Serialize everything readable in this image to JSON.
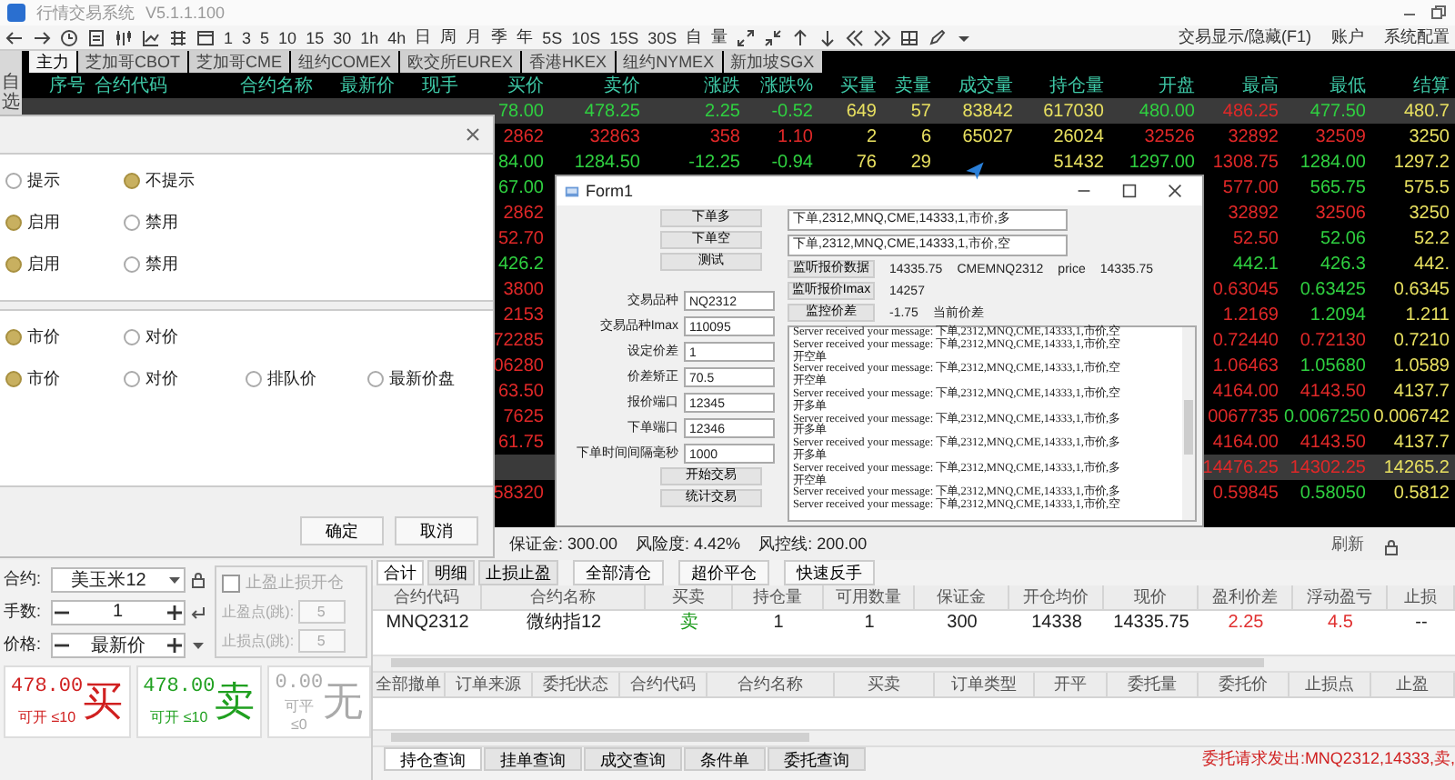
{
  "window": {
    "title": "行情交易系统",
    "version": "V5.1.1.100"
  },
  "toolbar": {
    "periods": [
      "1",
      "3",
      "5",
      "10",
      "15",
      "30",
      "1h",
      "4h",
      "日",
      "周",
      "月",
      "季",
      "年",
      "5S",
      "10S",
      "15S",
      "30S",
      "自",
      "量"
    ],
    "links": [
      "交易显示/隐藏(F1)",
      "账户",
      "系统配置"
    ]
  },
  "market_tabs": [
    {
      "label": "主力",
      "selected": true
    },
    {
      "label": "芝加哥CBOT",
      "selected": false
    },
    {
      "label": "芝加哥CME",
      "selected": false
    },
    {
      "label": "纽约COMEX",
      "selected": false
    },
    {
      "label": "欧交所EUREX",
      "selected": false
    },
    {
      "label": "香港HKEX",
      "selected": false
    },
    {
      "label": "纽约NYMEX",
      "selected": false
    },
    {
      "label": "新加坡SGX",
      "selected": false
    }
  ],
  "watchlist_label": "自选",
  "quote_table": {
    "columns": [
      "序号",
      "合约代码",
      "合约名称",
      "最新价",
      "现手",
      "买价",
      "卖价",
      "涨跌",
      "涨跌%",
      "买量",
      "卖量",
      "成交量",
      "持仓量",
      "开盘",
      "最高",
      "最低",
      "结算"
    ],
    "rows": [
      {
        "selected": true,
        "cells": [
          null,
          null,
          null,
          null,
          null,
          {
            "text": "78.00",
            "color": "#2fd040"
          },
          {
            "text": "478.25",
            "color": "#2fd040"
          },
          {
            "text": "2.25",
            "color": "#2fd040"
          },
          {
            "text": "-0.52",
            "color": "#2fd040"
          },
          {
            "text": "649",
            "color": "#e8e060"
          },
          {
            "text": "57",
            "color": "#e8e060"
          },
          {
            "text": "83842",
            "color": "#e8e060"
          },
          {
            "text": "617030",
            "color": "#e8e060"
          },
          {
            "text": "480.00",
            "color": "#2fd040"
          },
          {
            "text": "486.25",
            "color": "#e02828"
          },
          {
            "text": "477.50",
            "color": "#2fd040"
          },
          {
            "text": "480.7",
            "color": "#e8e060"
          }
        ]
      },
      {
        "selected": false,
        "cells": [
          null,
          null,
          null,
          null,
          null,
          {
            "text": "2862",
            "color": "#e02828"
          },
          {
            "text": "32863",
            "color": "#e02828"
          },
          {
            "text": "358",
            "color": "#e02828"
          },
          {
            "text": "1.10",
            "color": "#e02828"
          },
          {
            "text": "2",
            "color": "#e8e060"
          },
          {
            "text": "6",
            "color": "#e8e060"
          },
          {
            "text": "65027",
            "color": "#e8e060"
          },
          {
            "text": "26024",
            "color": "#e8e060"
          },
          {
            "text": "32526",
            "color": "#e02828"
          },
          {
            "text": "32892",
            "color": "#e02828"
          },
          {
            "text": "32509",
            "color": "#e02828"
          },
          {
            "text": "3250",
            "color": "#e8e060"
          }
        ]
      },
      {
        "selected": false,
        "cells": [
          null,
          null,
          null,
          null,
          null,
          {
            "text": "84.00",
            "color": "#2fd040"
          },
          {
            "text": "1284.50",
            "color": "#2fd040"
          },
          {
            "text": "-12.25",
            "color": "#2fd040"
          },
          {
            "text": "-0.94",
            "color": "#2fd040"
          },
          {
            "text": "76",
            "color": "#e8e060"
          },
          {
            "text": "29",
            "color": "#e8e060"
          },
          null,
          {
            "text": "51432",
            "color": "#e8e060"
          },
          {
            "text": "1297.00",
            "color": "#2fd040"
          },
          {
            "text": "1308.75",
            "color": "#e02828"
          },
          {
            "text": "1284.00",
            "color": "#2fd040"
          },
          {
            "text": "1297.2",
            "color": "#e8e060"
          }
        ]
      },
      {
        "selected": false,
        "cells": [
          null,
          null,
          null,
          null,
          null,
          {
            "text": "67.00",
            "color": "#2fd040"
          },
          null,
          null,
          null,
          null,
          null,
          null,
          null,
          null,
          {
            "text": "577.00",
            "color": "#e02828"
          },
          {
            "text": "565.75",
            "color": "#2fd040"
          },
          {
            "text": "575.5",
            "color": "#e8e060"
          }
        ]
      },
      {
        "selected": false,
        "cells": [
          null,
          null,
          null,
          null,
          null,
          {
            "text": "2862",
            "color": "#e02828"
          },
          null,
          null,
          null,
          null,
          null,
          null,
          null,
          null,
          {
            "text": "32892",
            "color": "#e02828"
          },
          {
            "text": "32506",
            "color": "#e02828"
          },
          {
            "text": "3250",
            "color": "#e8e060"
          }
        ]
      },
      {
        "selected": false,
        "cells": [
          null,
          null,
          null,
          null,
          null,
          {
            "text": "52.70",
            "color": "#e02828"
          },
          null,
          null,
          null,
          null,
          null,
          null,
          null,
          null,
          {
            "text": "52.50",
            "color": "#e02828"
          },
          {
            "text": "52.06",
            "color": "#2fd040"
          },
          {
            "text": "52.2",
            "color": "#e8e060"
          }
        ]
      },
      {
        "selected": false,
        "cells": [
          null,
          null,
          null,
          null,
          null,
          {
            "text": "426.2",
            "color": "#2fd040"
          },
          null,
          null,
          null,
          null,
          null,
          null,
          null,
          null,
          {
            "text": "442.1",
            "color": "#2fd040"
          },
          {
            "text": "426.3",
            "color": "#2fd040"
          },
          {
            "text": "442.",
            "color": "#e8e060"
          }
        ]
      },
      {
        "selected": false,
        "cells": [
          null,
          null,
          null,
          null,
          null,
          {
            "text": "3800",
            "color": "#e02828"
          },
          null,
          null,
          null,
          null,
          null,
          null,
          null,
          null,
          {
            "text": "0.63045",
            "color": "#e02828"
          },
          {
            "text": "0.63425",
            "color": "#2fd040"
          },
          {
            "text": "0.6345",
            "color": "#e8e060"
          }
        ]
      },
      {
        "selected": false,
        "cells": [
          null,
          null,
          null,
          null,
          null,
          {
            "text": "2153",
            "color": "#e02828"
          },
          null,
          null,
          null,
          null,
          null,
          null,
          null,
          null,
          {
            "text": "1.2169",
            "color": "#e02828"
          },
          {
            "text": "1.2094",
            "color": "#2fd040"
          },
          {
            "text": "1.211",
            "color": "#e8e060"
          }
        ]
      },
      {
        "selected": false,
        "cells": [
          null,
          null,
          null,
          null,
          null,
          {
            "text": "72285",
            "color": "#e02828"
          },
          null,
          null,
          null,
          null,
          null,
          null,
          null,
          null,
          {
            "text": "0.72440",
            "color": "#e02828"
          },
          {
            "text": "0.72130",
            "color": "#e02828"
          },
          {
            "text": "0.7210",
            "color": "#e8e060"
          }
        ]
      },
      {
        "selected": false,
        "cells": [
          null,
          null,
          null,
          null,
          null,
          {
            "text": "06280",
            "color": "#e02828"
          },
          null,
          null,
          null,
          null,
          null,
          null,
          null,
          null,
          {
            "text": "1.06463",
            "color": "#e02828"
          },
          {
            "text": "1.05680",
            "color": "#2fd040"
          },
          {
            "text": "1.0589",
            "color": "#e8e060"
          }
        ]
      },
      {
        "selected": false,
        "cells": [
          null,
          null,
          null,
          null,
          null,
          {
            "text": "63.50",
            "color": "#e02828"
          },
          null,
          null,
          null,
          null,
          null,
          null,
          null,
          null,
          {
            "text": "4164.00",
            "color": "#e02828"
          },
          {
            "text": "4143.50",
            "color": "#e02828"
          },
          {
            "text": "4137.7",
            "color": "#e8e060"
          }
        ]
      },
      {
        "selected": false,
        "cells": [
          null,
          null,
          null,
          null,
          null,
          {
            "text": "7625",
            "color": "#e02828"
          },
          null,
          null,
          null,
          null,
          null,
          null,
          null,
          null,
          {
            "text": "0067735",
            "color": "#e02828"
          },
          {
            "text": "0.0067250",
            "color": "#2fd040"
          },
          {
            "text": "0.006742",
            "color": "#e8e060"
          }
        ]
      },
      {
        "selected": false,
        "cells": [
          null,
          null,
          null,
          null,
          null,
          {
            "text": "61.75",
            "color": "#e02828"
          },
          null,
          null,
          null,
          null,
          null,
          null,
          null,
          null,
          {
            "text": "4164.00",
            "color": "#e02828"
          },
          {
            "text": "4143.50",
            "color": "#e02828"
          },
          {
            "text": "4137.7",
            "color": "#e8e060"
          }
        ]
      },
      {
        "selected": true,
        "cells": [
          null,
          null,
          null,
          null,
          null,
          null,
          null,
          null,
          null,
          null,
          null,
          null,
          null,
          null,
          {
            "text": "14476.25",
            "color": "#e02828"
          },
          {
            "text": "14302.25",
            "color": "#e02828"
          },
          {
            "text": "14265.2",
            "color": "#e8e060"
          }
        ]
      },
      {
        "selected": false,
        "cells": [
          null,
          null,
          null,
          null,
          null,
          {
            "text": "58320",
            "color": "#e02828"
          },
          null,
          null,
          null,
          null,
          null,
          null,
          null,
          null,
          {
            "text": "0.59845",
            "color": "#e02828"
          },
          {
            "text": "0.58050",
            "color": "#2fd040"
          },
          {
            "text": "0.5812",
            "color": "#e8e060"
          }
        ]
      }
    ]
  },
  "settings_dialog": {
    "groups": [
      {
        "rows": [
          {
            "options": [
              {
                "label": "提示",
                "selected": false
              },
              {
                "label": "不提示",
                "selected": true
              }
            ]
          },
          {
            "options": [
              {
                "label": "启用",
                "selected": true
              },
              {
                "label": "禁用",
                "selected": false
              }
            ]
          },
          {
            "options": [
              {
                "label": "启用",
                "selected": true
              },
              {
                "label": "禁用",
                "selected": false
              }
            ]
          }
        ]
      },
      {
        "rows": [
          {
            "options": [
              {
                "label": "市价",
                "selected": true
              },
              {
                "label": "对价",
                "selected": false
              }
            ]
          },
          {
            "options": [
              {
                "label": "市价",
                "selected": true
              },
              {
                "label": "对价",
                "selected": false
              },
              {
                "label": "排队价",
                "selected": false
              },
              {
                "label": "最新价盘",
                "selected": false
              }
            ]
          }
        ]
      }
    ],
    "buttons": [
      "确定",
      "取消"
    ]
  },
  "form1": {
    "title": "Form1",
    "order_buttons": [
      "下单多",
      "下单空",
      "测试"
    ],
    "fields": [
      {
        "label": "交易品种",
        "value": "NQ2312"
      },
      {
        "label": "交易品种Imax",
        "value": "110095"
      },
      {
        "label": "设定价差",
        "value": "1"
      },
      {
        "label": "价差矫正",
        "value": "70.5"
      },
      {
        "label": "报价端口",
        "value": "12345"
      },
      {
        "label": "下单端口",
        "value": "12346"
      },
      {
        "label": "下单时间间隔毫秒",
        "value": "1000"
      }
    ],
    "action_buttons": [
      "开始交易",
      "统计交易"
    ],
    "commands": [
      "下单,2312,MNQ,CME,14333,1,市价,多",
      "下单,2312,MNQ,CME,14333,1,市价,空"
    ],
    "monitors": [
      {
        "button": "监听报价数据",
        "value": "14335.75",
        "extra": [
          "CMEMNQ2312",
          "price",
          "14335.75"
        ]
      },
      {
        "button": "监听报价Imax",
        "value": "14257"
      },
      {
        "button": "监控价差",
        "value": "-1.75",
        "extra": [
          "当前价差"
        ]
      }
    ],
    "log": [
      "Server received your message: 下单,2312,MNQ,CME,14333,1,市价,空",
      "Server received your message: 下单,2312,MNQ,CME,14333,1,市价,空",
      "开空单",
      "Server received your message: 下单,2312,MNQ,CME,14333,1,市价,空",
      "开空单",
      "Server received your message: 下单,2312,MNQ,CME,14333,1,市价,空",
      "开多单",
      "Server received your message: 下单,2312,MNQ,CME,14333,1,市价,多",
      "开多单",
      "Server received your message: 下单,2312,MNQ,CME,14333,1,市价,多",
      "开多单",
      "Server received your message: 下单,2312,MNQ,CME,14333,1,市价,多",
      "开空单",
      "Server received your message: 下单,2312,MNQ,CME,14333,1,市价,多",
      "Server received your message: 下单,2312,MNQ,CME,14333,1,市价,空"
    ]
  },
  "account_summary": [
    "保证金: 300.00",
    "风险度: 4.42%",
    "风控线: 200.00"
  ],
  "refresh_label": "刷新",
  "order_panel": {
    "contract": {
      "label": "合约:",
      "value": "美玉米12"
    },
    "lots": {
      "label": "手数:",
      "value": "1"
    },
    "price": {
      "label": "价格:",
      "value": "最新价"
    },
    "stop_group": {
      "label": "止盈止损开仓",
      "checked": false,
      "disabled": true,
      "fields": [
        {
          "label": "止盈点(跳):",
          "value": "5"
        },
        {
          "label": "止损点(跳):",
          "value": "5"
        }
      ]
    },
    "trade_buttons": [
      {
        "kind": "buy",
        "price": "478.00",
        "action": "买",
        "limit": "可开 ≤10"
      },
      {
        "kind": "sell",
        "price": "478.00",
        "action": "卖",
        "limit": "可开 ≤10"
      },
      {
        "kind": "none",
        "price": "0.00",
        "action": "无",
        "limit": "可平 ≤0"
      }
    ]
  },
  "positions": {
    "tabs": [
      {
        "label": "合计",
        "selected": true
      },
      {
        "label": "明细",
        "selected": false
      },
      {
        "label": "止损止盈",
        "selected": false
      }
    ],
    "actions": [
      "全部清仓",
      "超价平仓",
      "快速反手"
    ],
    "columns": [
      "合约代码",
      "合约名称",
      "买卖",
      "持仓量",
      "可用数量",
      "保证金",
      "开仓均价",
      "现价",
      "盈利价差",
      "浮动盈亏",
      "止损"
    ],
    "rows": [
      {
        "cells": [
          {
            "text": "MNQ2312",
            "color": "#202020"
          },
          {
            "text": "微纳指12",
            "color": "#202020"
          },
          {
            "text": "卖",
            "color": "#1a9a1a"
          },
          {
            "text": "1",
            "color": "#202020"
          },
          {
            "text": "1",
            "color": "#202020"
          },
          {
            "text": "300",
            "color": "#202020"
          },
          {
            "text": "14338",
            "color": "#202020"
          },
          {
            "text": "14335.75",
            "color": "#202020"
          },
          {
            "text": "2.25",
            "color": "#e03030"
          },
          {
            "text": "4.5",
            "color": "#e03030"
          },
          {
            "text": "--",
            "color": "#202020"
          }
        ]
      }
    ]
  },
  "orders": {
    "columns": [
      "全部撤单",
      "订单来源",
      "委托状态",
      "合约代码",
      "合约名称",
      "买卖",
      "订单类型",
      "开平",
      "委托量",
      "委托价",
      "止损点",
      "止盈"
    ]
  },
  "bottom_tabs": [
    {
      "label": "持仓查询",
      "selected": true
    },
    {
      "label": "挂单查询",
      "selected": false
    },
    {
      "label": "成交查询",
      "selected": false
    },
    {
      "label": "条件单",
      "selected": false
    },
    {
      "label": "委托查询",
      "selected": false
    }
  ],
  "status_message": "委托请求发出:MNQ2312,14333,卖,"
}
